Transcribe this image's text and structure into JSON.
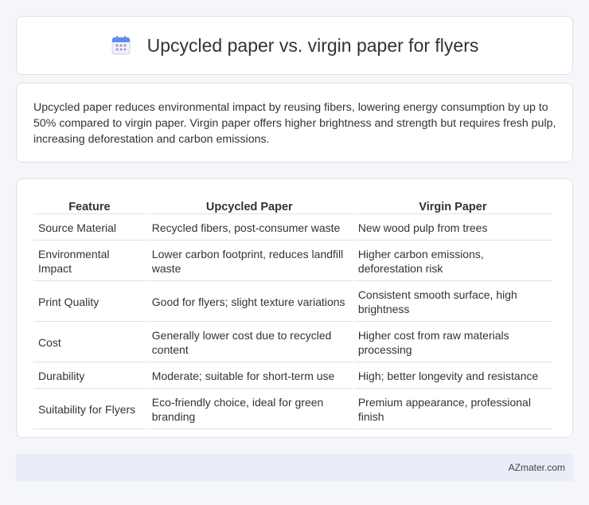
{
  "header": {
    "icon": "calendar-icon",
    "title": "Upcycled paper vs. virgin paper for flyers"
  },
  "summary": {
    "text": "Upcycled paper reduces environmental impact by reusing fibers, lowering energy consumption by up to 50% compared to virgin paper. Virgin paper offers higher brightness and strength but requires fresh pulp, increasing deforestation and carbon emissions."
  },
  "table": {
    "headers": [
      "Feature",
      "Upcycled Paper",
      "Virgin Paper"
    ],
    "rows": [
      [
        "Source Material",
        "Recycled fibers, post-consumer waste",
        "New wood pulp from trees"
      ],
      [
        "Environmental Impact",
        "Lower carbon footprint, reduces landfill waste",
        "Higher carbon emissions, deforestation risk"
      ],
      [
        "Print Quality",
        "Good for flyers; slight texture variations",
        "Consistent smooth surface, high brightness"
      ],
      [
        "Cost",
        "Generally lower cost due to recycled content",
        "Higher cost from raw materials processing"
      ],
      [
        "Durability",
        "Moderate; suitable for short-term use",
        "High; better longevity and resistance"
      ],
      [
        "Suitability for Flyers",
        "Eco-friendly choice, ideal for green branding",
        "Premium appearance, professional finish"
      ]
    ]
  },
  "footer": {
    "text": "AZmater.com"
  },
  "colors": {
    "background": "#f5f6fa",
    "card": "#ffffff",
    "border": "#dde1ea",
    "footer_bg": "#e8edf7",
    "icon_accent": "#5b8def",
    "icon_dots": "#a78bda"
  }
}
